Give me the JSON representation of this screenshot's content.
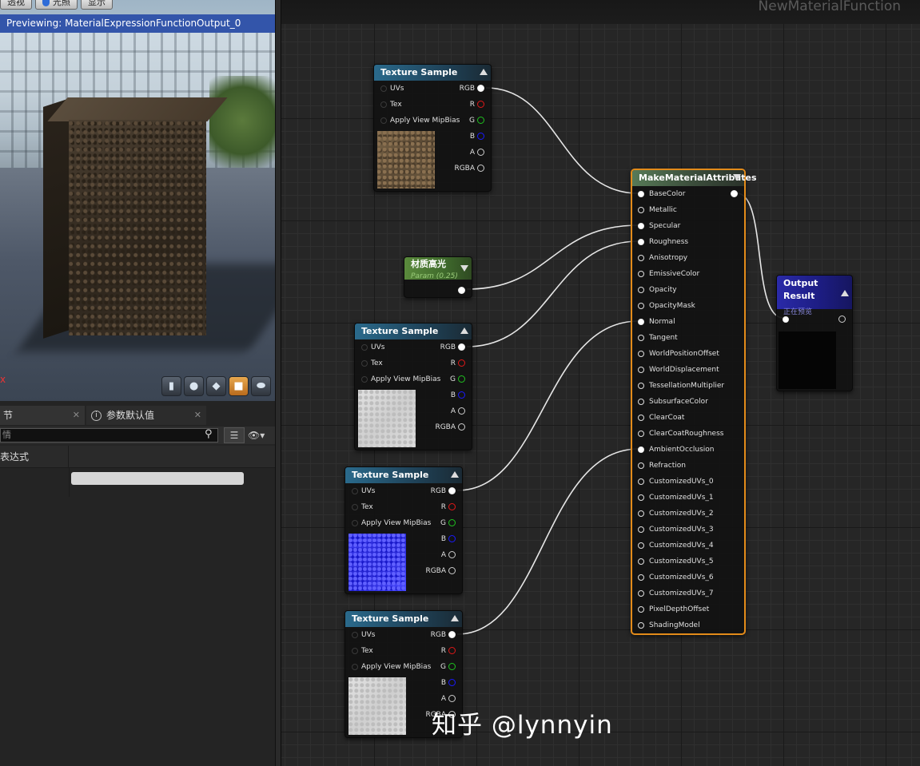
{
  "viewport": {
    "toolbar": {
      "perspective_label": "透视",
      "lit_label": "光照",
      "show_label": "显示"
    },
    "preview_banner": "Previewing: MaterialExpressionFunctionOutput_0",
    "axis_marker": "x"
  },
  "details": {
    "tabs": [
      {
        "label": "节"
      },
      {
        "label": "参数默认值"
      }
    ],
    "search": {
      "placeholder": "情"
    },
    "section_label": "表达式"
  },
  "graph": {
    "title": "NewMaterialFunction",
    "watermark": "知乎 @lynnyin",
    "texture_nodes": [
      {
        "title": "Texture Sample"
      },
      {
        "title": "Texture Sample"
      },
      {
        "title": "Texture Sample"
      },
      {
        "title": "Texture Sample"
      }
    ],
    "texture_pins": {
      "inputs": [
        "UVs",
        "Tex",
        "Apply View MipBias"
      ],
      "outputs": [
        "RGB",
        "R",
        "G",
        "B",
        "A",
        "RGBA"
      ]
    },
    "param_node": {
      "title": "材质高光",
      "subtitle": "Param (0.25)"
    },
    "make_attributes_node": {
      "title": "MakeMaterialAttributes",
      "inputs": [
        "BaseColor",
        "Metallic",
        "Specular",
        "Roughness",
        "Anisotropy",
        "EmissiveColor",
        "Opacity",
        "OpacityMask",
        "Normal",
        "Tangent",
        "WorldPositionOffset",
        "WorldDisplacement",
        "TessellationMultiplier",
        "SubsurfaceColor",
        "ClearCoat",
        "ClearCoatRoughness",
        "AmbientOcclusion",
        "Refraction",
        "CustomizedUVs_0",
        "CustomizedUVs_1",
        "CustomizedUVs_2",
        "CustomizedUVs_3",
        "CustomizedUVs_4",
        "CustomizedUVs_5",
        "CustomizedUVs_6",
        "CustomizedUVs_7",
        "PixelDepthOffset",
        "ShadingModel"
      ]
    },
    "output_node": {
      "title": "Output Result",
      "subtitle": "正在预览"
    }
  }
}
